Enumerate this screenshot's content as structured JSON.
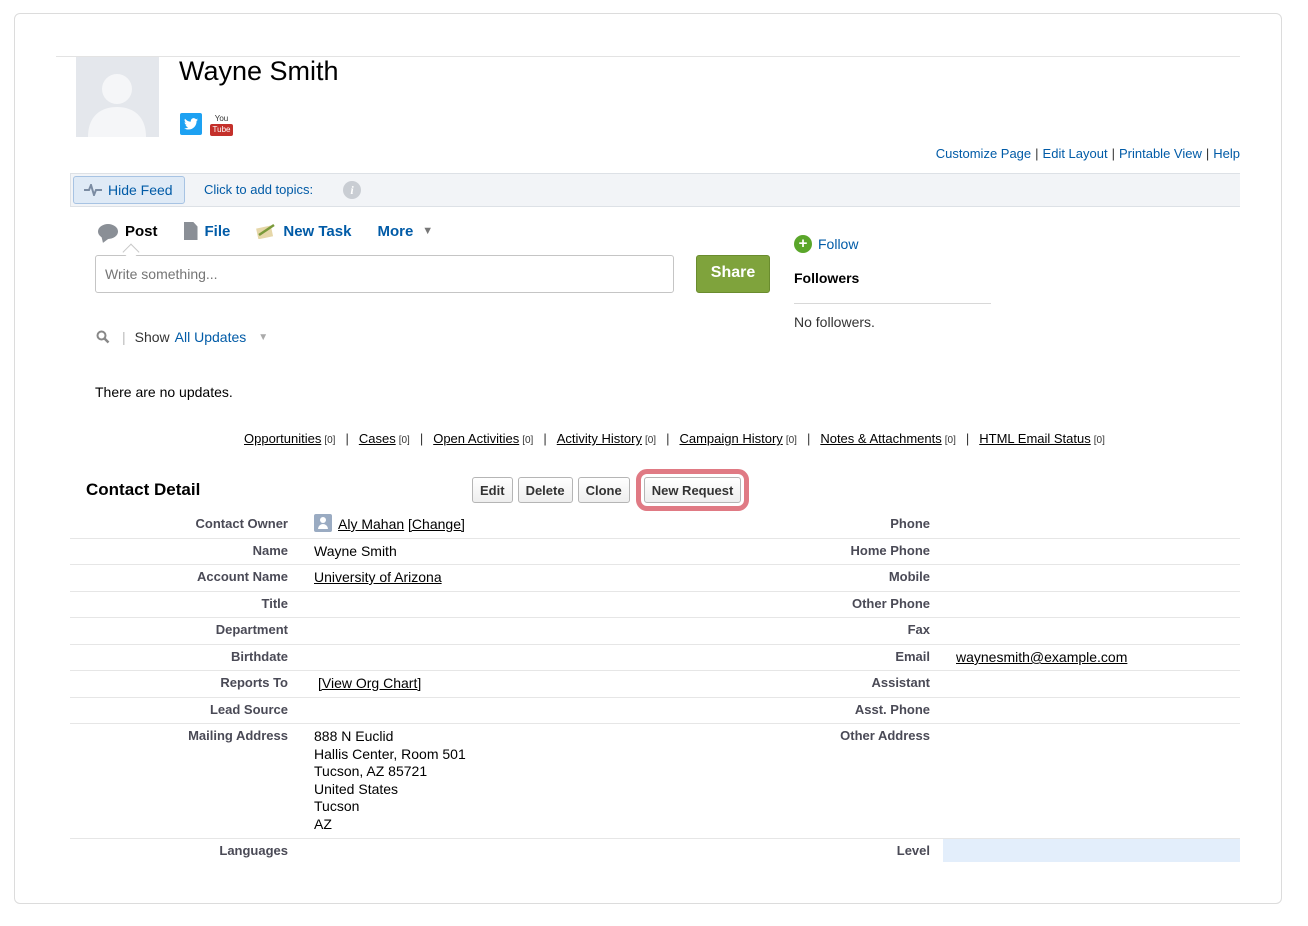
{
  "contact": {
    "name": "Wayne Smith",
    "social": {
      "twitter_icon": "twitter-icon",
      "youtube_you": "You",
      "youtube_tube": "Tube"
    }
  },
  "page_links": [
    "Customize Page",
    "Edit Layout",
    "Printable View",
    "Help"
  ],
  "feed": {
    "hide_feed_label": "Hide Feed",
    "topics_label": "Click to add topics:",
    "info_glyph": "i",
    "publisher": {
      "post": "Post",
      "file": "File",
      "new_task": "New Task",
      "more": "More"
    },
    "write_placeholder": "Write something...",
    "share_label": "Share",
    "show_label": "Show",
    "filter_value": "All Updates",
    "no_updates": "There are no updates."
  },
  "followers": {
    "follow_label": "Follow",
    "heading": "Followers",
    "empty": "No followers."
  },
  "related_lists": [
    {
      "label": "Opportunities",
      "count": "[0]"
    },
    {
      "label": "Cases",
      "count": "[0]"
    },
    {
      "label": "Open Activities",
      "count": "[0]"
    },
    {
      "label": "Activity History",
      "count": "[0]"
    },
    {
      "label": "Campaign History",
      "count": "[0]"
    },
    {
      "label": "Notes & Attachments",
      "count": "[0]"
    },
    {
      "label": "HTML Email Status",
      "count": "[0]"
    }
  ],
  "detail": {
    "title": "Contact Detail",
    "buttons": {
      "edit": "Edit",
      "delete": "Delete",
      "clone": "Clone",
      "new_request": "New Request"
    },
    "left": {
      "contact_owner": {
        "label": "Contact Owner",
        "value": "Aly Mahan",
        "change": "[Change]"
      },
      "name": {
        "label": "Name",
        "value": "Wayne Smith"
      },
      "account_name": {
        "label": "Account Name",
        "value": "University of Arizona"
      },
      "title": {
        "label": "Title",
        "value": ""
      },
      "department": {
        "label": "Department",
        "value": ""
      },
      "birthdate": {
        "label": "Birthdate",
        "value": ""
      },
      "reports_to": {
        "label": "Reports To",
        "value": "[View Org Chart]"
      },
      "lead_source": {
        "label": "Lead Source",
        "value": ""
      },
      "mailing_address": {
        "label": "Mailing Address",
        "lines": [
          "888 N Euclid",
          "Hallis Center, Room 501",
          "Tucson, AZ 85721",
          "United States",
          "Tucson",
          "AZ"
        ]
      },
      "languages": {
        "label": "Languages",
        "value": ""
      }
    },
    "right": {
      "phone": {
        "label": "Phone",
        "value": ""
      },
      "home_phone": {
        "label": "Home Phone",
        "value": ""
      },
      "mobile": {
        "label": "Mobile",
        "value": ""
      },
      "other_phone": {
        "label": "Other Phone",
        "value": ""
      },
      "fax": {
        "label": "Fax",
        "value": ""
      },
      "email": {
        "label": "Email",
        "value": "waynesmith@example.com"
      },
      "assistant": {
        "label": "Assistant",
        "value": ""
      },
      "asst_phone": {
        "label": "Asst. Phone",
        "value": ""
      },
      "other_address": {
        "label": "Other Address",
        "value": ""
      },
      "level": {
        "label": "Level",
        "value": ""
      }
    }
  },
  "colors": {
    "link": "#015ba7",
    "share": "#7fa33c",
    "highlight": "#e07a84"
  }
}
